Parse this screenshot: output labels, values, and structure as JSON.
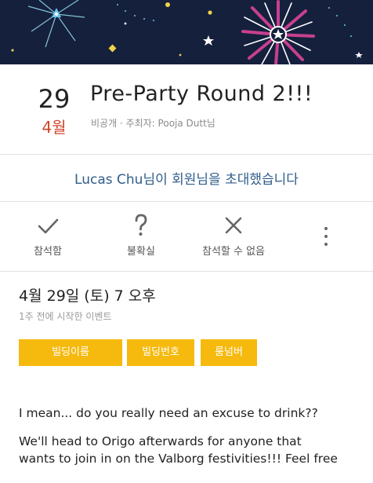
{
  "event": {
    "day": "29",
    "month": "4월",
    "title": "Pre-Party Round 2!!!",
    "subtitle": "비공개 · 주최자: Pooja Dutt님"
  },
  "invite": {
    "text": "Lucas Chu님이 회원님을 초대했습니다"
  },
  "rsvp": {
    "going_label": "참석함",
    "maybe_label": "불확실",
    "cant_go_label": "참석할 수 없음",
    "going_icon": "check-icon",
    "maybe_icon": "question-icon",
    "cant_go_icon": "x-icon",
    "more_icon": "more-vertical-icon"
  },
  "when": {
    "datetime": "4월 29일 (토) 7 오후",
    "started": "1주 전에 시작한 이벤트"
  },
  "tags": [
    "빌딩이름",
    "빌딩번호",
    "룸넘버"
  ],
  "description": {
    "line1": "I mean... do you really need an excuse to drink??",
    "line2": "We'll head to Origo afterwards for anyone that",
    "line3": "wants to join in on the Valborg festivities!!! Feel free"
  },
  "colors": {
    "banner_bg": "#15203d",
    "month_red": "#d2452d",
    "invite_blue": "#2f5d8a",
    "tag_yellow": "#f6b90d"
  }
}
